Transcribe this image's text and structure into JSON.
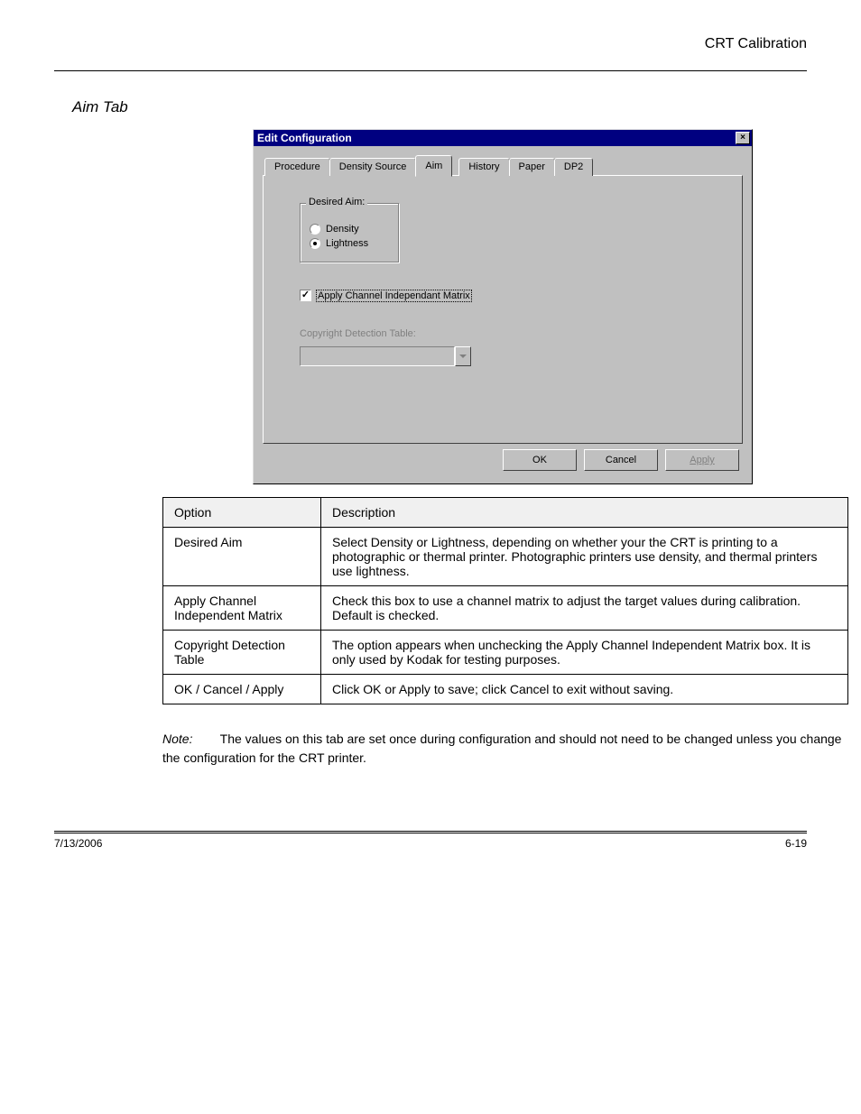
{
  "header_right": "CRT Calibration",
  "section_heading": "Aim Tab",
  "dialog": {
    "title": "Edit Configuration",
    "tabs": [
      "Procedure",
      "Density Source",
      "Aim",
      "History",
      "Paper",
      "DP2"
    ],
    "active_tab": "Aim",
    "group_legend": "Desired Aim:",
    "radio_density": "Density",
    "radio_lightness": "Lightness",
    "cim_label": "Apply Channel Independant Matrix",
    "cdt_label": "Copyright Detection Table:",
    "ok": "OK",
    "cancel": "Cancel",
    "apply": "Apply"
  },
  "table": {
    "h1": "Option",
    "h2": "Description",
    "rows": [
      {
        "o": "Desired Aim",
        "d": "Select Density or Lightness, depending on whether your the CRT is printing to a photographic or thermal printer. Photographic printers use density, and thermal printers use lightness."
      },
      {
        "o": "Apply Channel Independent Matrix",
        "d": "Check this box to use a channel matrix to adjust the target values during calibration. Default is checked."
      },
      {
        "o": "Copyright Detection Table",
        "d": "The option appears when unchecking the Apply Channel Independent Matrix box. It is only used by Kodak for testing purposes."
      },
      {
        "o": "OK / Cancel / Apply",
        "d": "Click OK or Apply to save; click Cancel to exit without saving."
      }
    ]
  },
  "note_label": "Note:",
  "note_text": "The values on this tab are set once during configuration and should not need to be changed unless you change the configuration for the CRT printer.",
  "footer": {
    "date": "7/13/2006",
    "page": "6-19"
  }
}
